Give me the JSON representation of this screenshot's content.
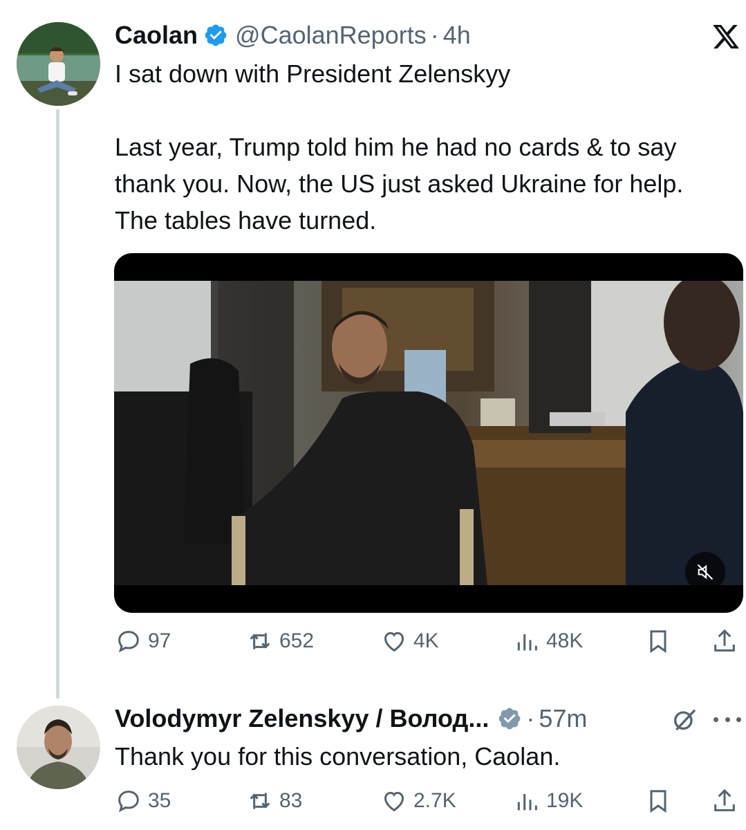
{
  "tweet": {
    "author_name": "Caolan",
    "author_handle": "@CaolanReports",
    "separator": "·",
    "time": "4h",
    "text": "I sat down with President Zelenskyy\n\nLast year, Trump told him he had no cards & to say thank you. Now, the US just asked Ukraine for help. The tables have turned.",
    "verified": true,
    "media": {
      "type": "video",
      "muted": true,
      "mute_icon": "speaker-muted-icon"
    },
    "stats": {
      "replies": "97",
      "reposts": "652",
      "likes": "4K",
      "views": "48K"
    }
  },
  "reply": {
    "author_name": "Volodymyr Zelenskyy / Волод...",
    "separator": "·",
    "time": "57m",
    "text": "Thank you for this conversation, Caolan.",
    "verified": true,
    "badge_color": "#829aab",
    "stats": {
      "replies": "35",
      "reposts": "83",
      "likes": "2.7K",
      "views": "19K"
    }
  },
  "icons": {
    "platform_logo": "x-logo-icon",
    "reply": "reply-icon",
    "repost": "repost-icon",
    "like": "heart-icon",
    "views": "views-icon",
    "bookmark": "bookmark-icon",
    "share": "share-icon",
    "grok": "grok-icon",
    "more": "more-icon"
  },
  "colors": {
    "verified_blue": "#1d9bf0",
    "muted_text": "#536471",
    "thread_line": "#cfd9de"
  }
}
